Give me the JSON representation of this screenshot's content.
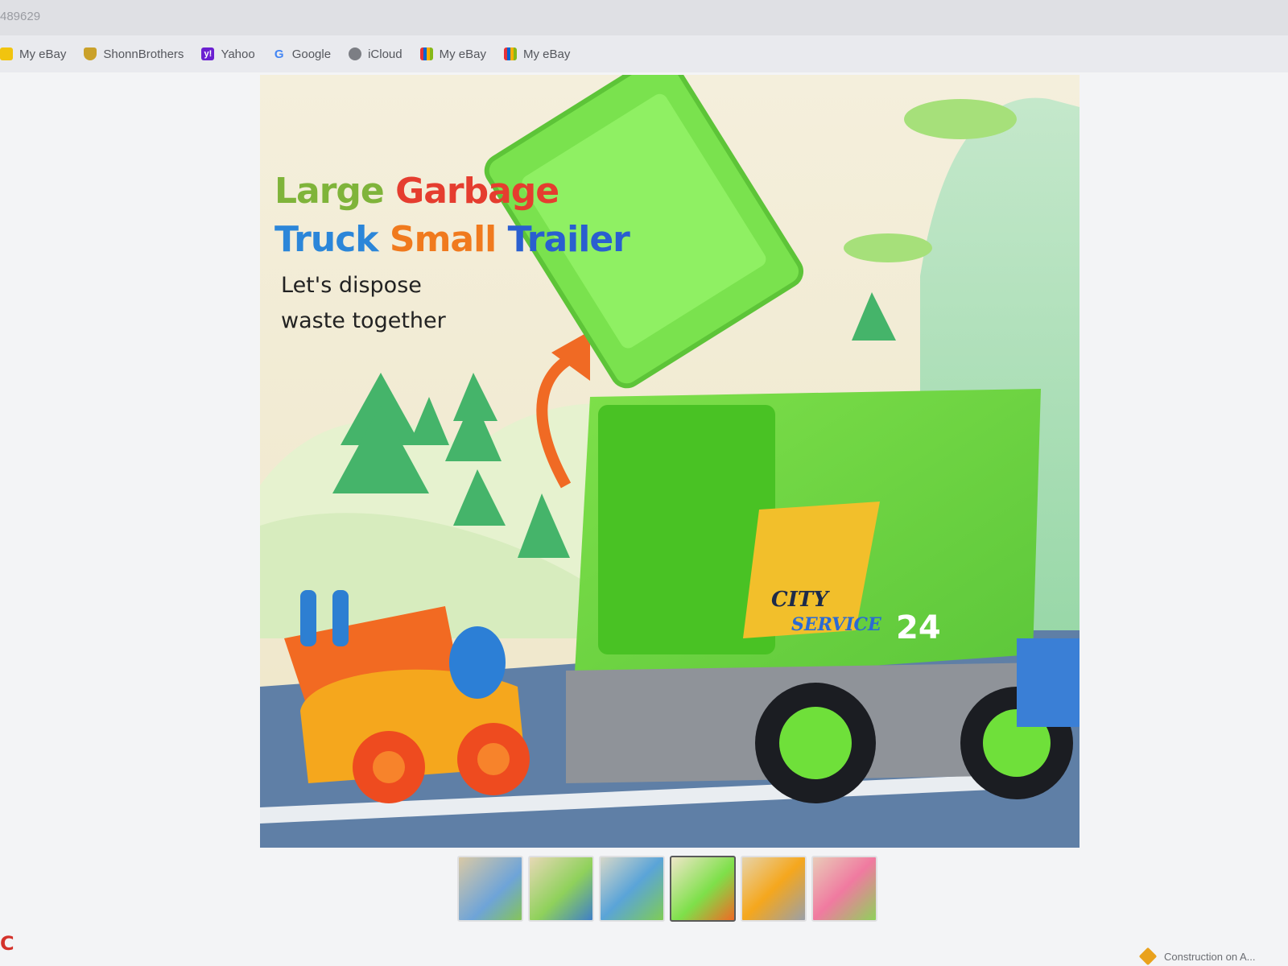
{
  "browser": {
    "url_fragment": "489629",
    "bookmarks": [
      {
        "label": "My eBay",
        "icon": "ebay-bag-icon"
      },
      {
        "label": "ShonnBrothers",
        "icon": "shield-icon"
      },
      {
        "label": "Yahoo",
        "icon": "yahoo-icon"
      },
      {
        "label": "Google",
        "icon": "google-icon"
      },
      {
        "label": "iCloud",
        "icon": "apple-icon"
      },
      {
        "label": "My eBay",
        "icon": "ebay-bag-icon"
      },
      {
        "label": "My eBay",
        "icon": "ebay-bag-icon"
      }
    ]
  },
  "product_image": {
    "headline_line1": [
      "Large",
      "Garbage"
    ],
    "headline_line2": [
      "Truck",
      "Small",
      "Trailer"
    ],
    "headline_colors": [
      "#7fb43a",
      "#e53d2f",
      "#2b86d9",
      "#f07a1e",
      "#2a5fd0"
    ],
    "subline1": "Let's dispose",
    "subline2": "waste together",
    "truck_label_top": "CITY",
    "truck_label_bottom": "SERVICE",
    "truck_number": "24"
  },
  "thumbnails": {
    "count": 6,
    "active_index": 3
  },
  "status_bar": {
    "text": "Construction on A..."
  }
}
